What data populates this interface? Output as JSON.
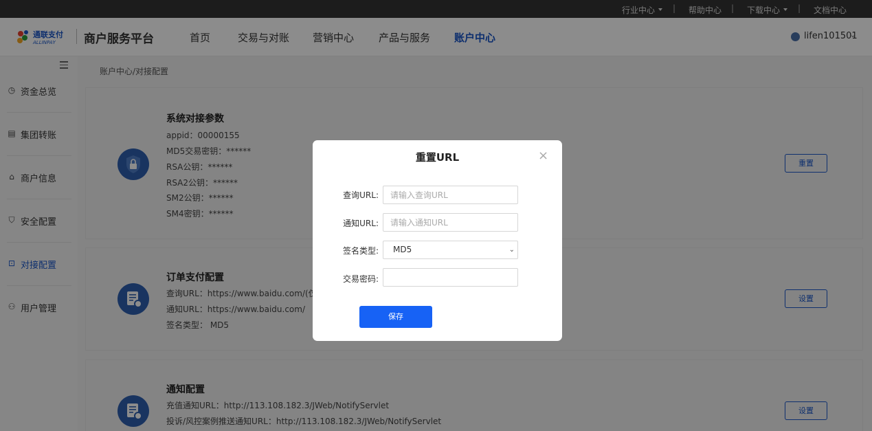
{
  "topbar": {
    "industry": "行业中心",
    "help": "帮助中心",
    "download": "下载中心",
    "docs": "文档中心",
    "sep": "|"
  },
  "header": {
    "logo_text": "通联支付",
    "logo_subtext": "ALLINPAY",
    "platform": "商户服务平台",
    "nav": [
      "首页",
      "交易与对账",
      "营销中心",
      "产品与服务",
      "账户中心"
    ],
    "user": "lifen101501"
  },
  "sidebar": {
    "items": [
      "资金总览",
      "集团转账",
      "商户信息",
      "安全配置",
      "对接配置",
      "用户管理"
    ]
  },
  "breadcrumb": "账户中心/对接配置",
  "cards": {
    "system": {
      "title": "系统对接参数",
      "lines": [
        "appid：00000155",
        "MD5交易密钥：******",
        "RSA公钥：******",
        "RSA2公钥：******",
        "SM2公钥：******",
        "SM4密钥：******"
      ],
      "button": "重置"
    },
    "order": {
      "title": "订单支付配置",
      "lines": [
        "查询URL：https://www.baidu.com/(仅支持",
        "通知URL：https://www.baidu.com/",
        "签名类型：  MD5"
      ],
      "button": "设置"
    },
    "notify": {
      "title": "通知配置",
      "lines": [
        "充值通知URL：http://113.108.182.3/JWeb/NotifyServlet",
        "投诉/风控案例推送通知URL：http://113.108.182.3/JWeb/NotifyServlet"
      ],
      "button": "设置"
    }
  },
  "modal": {
    "title": "重置URL",
    "close": "×",
    "query_label": "查询URL:",
    "query_placeholder": "请输入查询URL",
    "notify_label": "通知URL:",
    "notify_placeholder": "请输入通知URL",
    "sign_label": "签名类型:",
    "sign_value": "MD5",
    "pwd_label": "交易密码:",
    "save": "保存"
  }
}
